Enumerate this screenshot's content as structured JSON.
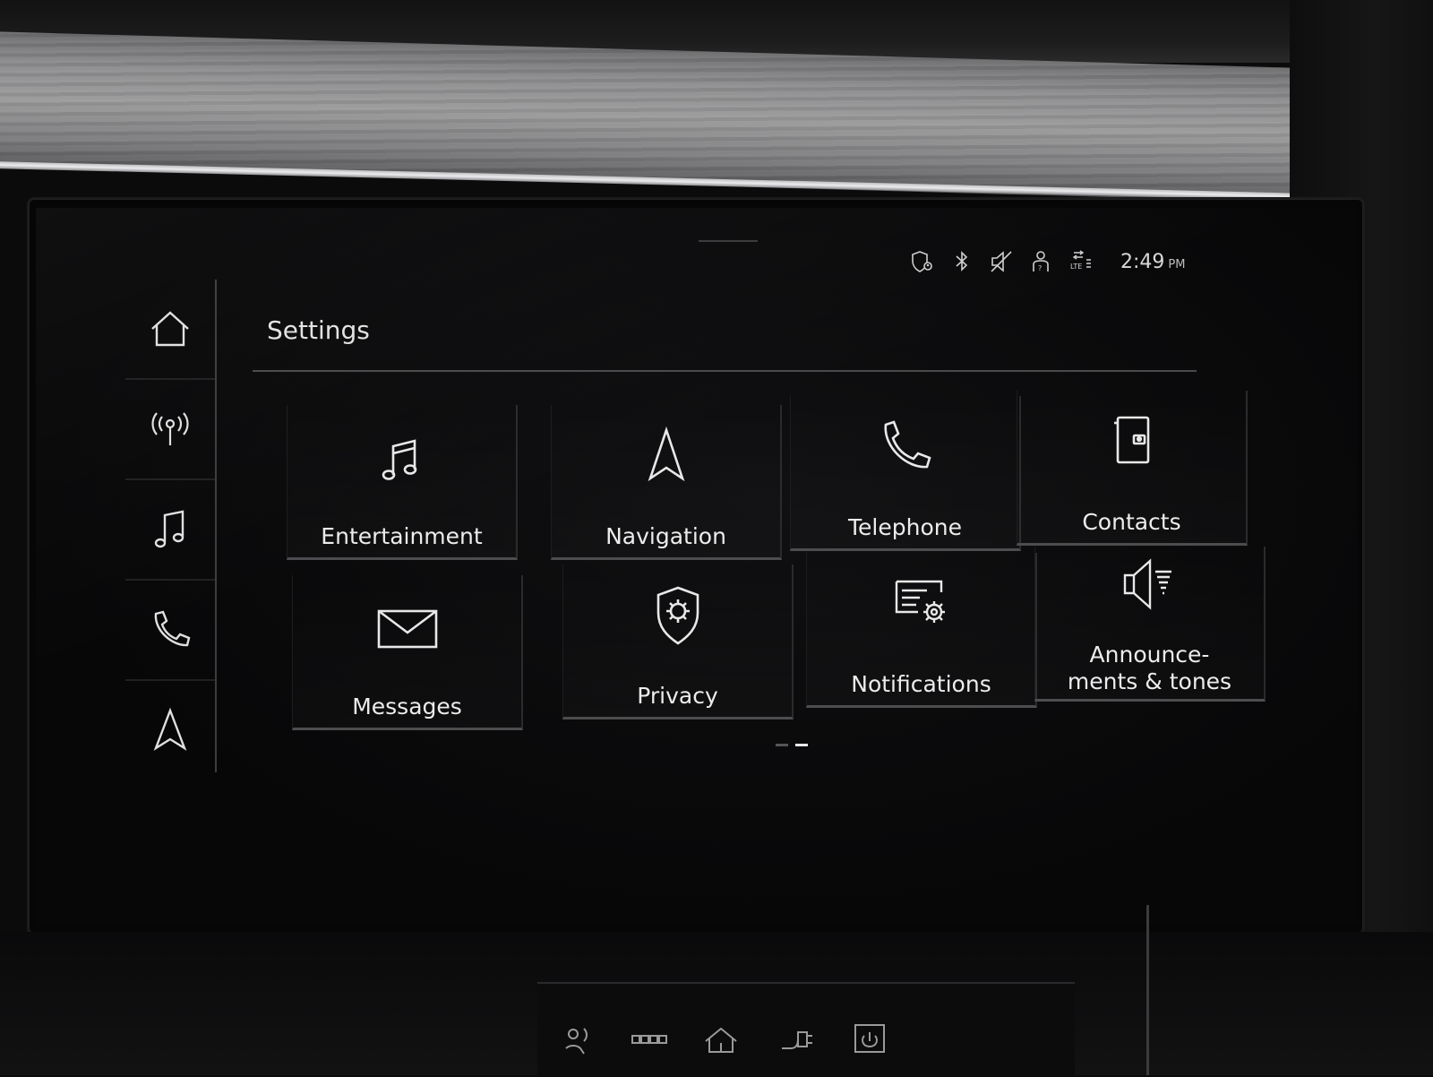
{
  "status_bar": {
    "icons": [
      "privacy-location-icon",
      "bluetooth-icon",
      "mute-icon",
      "user-icon",
      "lte-data-icon"
    ],
    "lte_label": "LTE",
    "time": "2:49",
    "ampm": "PM"
  },
  "left_rail": {
    "items": [
      "home-icon",
      "radio-icon",
      "music-icon",
      "phone-icon",
      "navigation-icon"
    ]
  },
  "page": {
    "title": "Settings"
  },
  "tiles": [
    {
      "label": "Entertainment",
      "icon": "music-note-icon"
    },
    {
      "label": "Navigation",
      "icon": "navigation-arrow-icon"
    },
    {
      "label": "Telephone",
      "icon": "phone-handset-icon"
    },
    {
      "label": "Contacts",
      "icon": "contacts-book-icon"
    },
    {
      "label": "Messages",
      "icon": "envelope-icon"
    },
    {
      "label": "Privacy",
      "icon": "privacy-shield-icon"
    },
    {
      "label": "Notifications",
      "icon": "notifications-gear-icon"
    },
    {
      "label": "Announce-",
      "label2": "ments & tones",
      "icon": "speaker-icon"
    }
  ],
  "pagination": {
    "pages": 2,
    "current": 2
  },
  "console": {
    "buttons": [
      "climate-icon",
      "seat-heat-icon",
      "home-hw-icon",
      "charging-plug-icon",
      "power-icon"
    ]
  },
  "colors": {
    "background": "#070708",
    "text": "#ececec",
    "divider": "#4a4a4d"
  }
}
